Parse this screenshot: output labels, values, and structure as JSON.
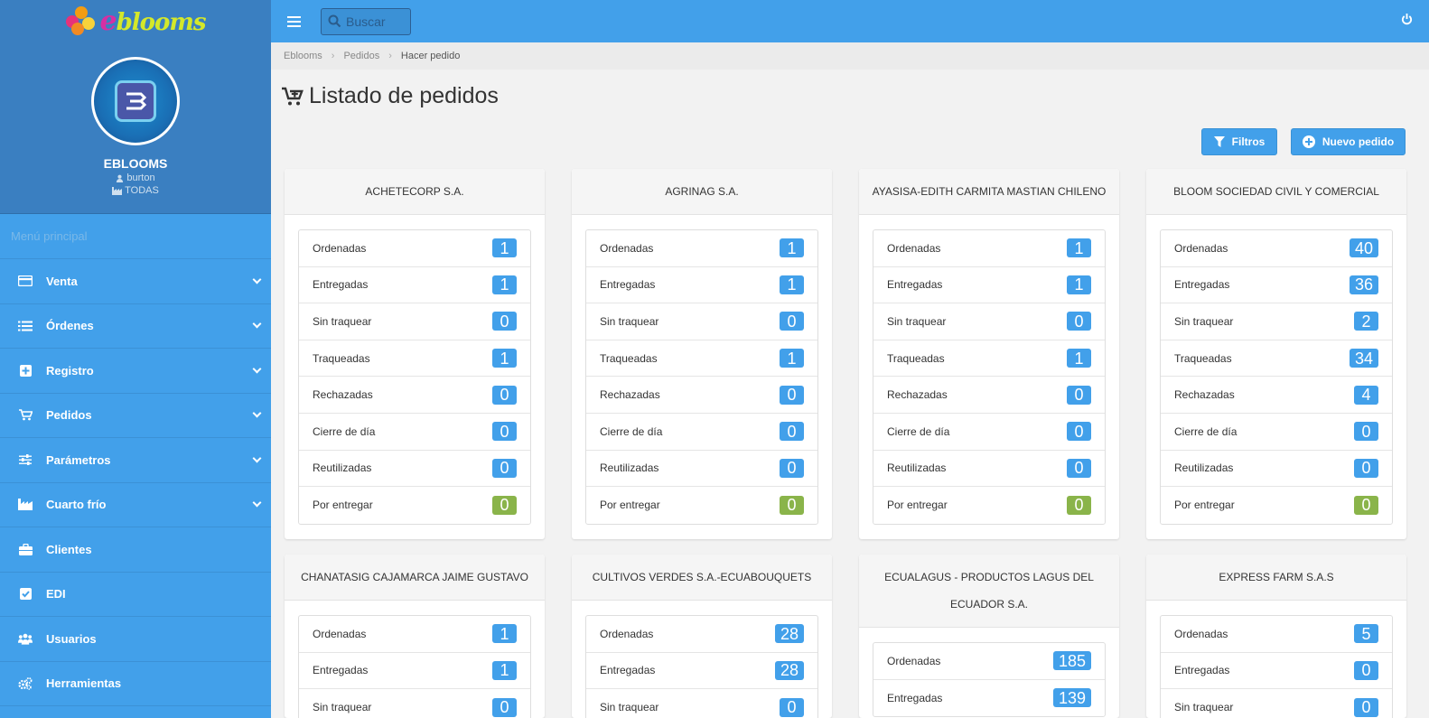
{
  "brand": {
    "logo_text": "blooms",
    "logo_initial": "e"
  },
  "profile": {
    "name": "EBLOOMS",
    "user": "burton",
    "farm": "TODAS"
  },
  "menu": {
    "label": "Menú principal",
    "items": [
      {
        "label": "Venta",
        "icon": "credit-card-icon",
        "expandable": true
      },
      {
        "label": "Órdenes",
        "icon": "list-icon",
        "expandable": true
      },
      {
        "label": "Registro",
        "icon": "plus-square-icon",
        "expandable": true
      },
      {
        "label": "Pedidos",
        "icon": "cart-icon",
        "expandable": true
      },
      {
        "label": "Parámetros",
        "icon": "sliders-icon",
        "expandable": true
      },
      {
        "label": "Cuarto frío",
        "icon": "factory-icon",
        "expandable": true
      },
      {
        "label": "Clientes",
        "icon": "briefcase-icon",
        "expandable": false
      },
      {
        "label": "EDI",
        "icon": "check-square-icon",
        "expandable": false
      },
      {
        "label": "Usuarios",
        "icon": "users-icon",
        "expandable": false
      },
      {
        "label": "Herramientas",
        "icon": "cogs-icon",
        "expandable": false
      }
    ]
  },
  "topbar": {
    "search_placeholder": "Buscar"
  },
  "breadcrumb": [
    "Eblooms",
    "Pedidos",
    "Hacer pedido"
  ],
  "page": {
    "title": "Listado de pedidos"
  },
  "buttons": {
    "filters": "Filtros",
    "new_order": "Nuevo pedido"
  },
  "stat_labels": [
    "Ordenadas",
    "Entregadas",
    "Sin traquear",
    "Traqueadas",
    "Rechazadas",
    "Cierre de día",
    "Reutilizadas",
    "Por entregar"
  ],
  "cards": [
    {
      "name": "ACHETECORP S.A.",
      "values": [
        "1",
        "1",
        "0",
        "1",
        "0",
        "0",
        "0",
        "0"
      ]
    },
    {
      "name": "AGRINAG S.A.",
      "values": [
        "1",
        "1",
        "0",
        "1",
        "0",
        "0",
        "0",
        "0"
      ]
    },
    {
      "name": "AYASISA-EDITH CARMITA MASTIAN CHILENO",
      "values": [
        "1",
        "1",
        "0",
        "1",
        "0",
        "0",
        "0",
        "0"
      ]
    },
    {
      "name": "BLOOM SOCIEDAD CIVIL Y COMERCIAL",
      "values": [
        "40",
        "36",
        "2",
        "34",
        "4",
        "0",
        "0",
        "0"
      ]
    },
    {
      "name": "CHANATASIG CAJAMARCA JAIME GUSTAVO",
      "values": [
        "1",
        "1",
        "0"
      ]
    },
    {
      "name": "CULTIVOS VERDES S.A.-ECUABOUQUETS",
      "values": [
        "28",
        "28",
        "0"
      ]
    },
    {
      "name": "ECUALAGUS - PRODUCTOS LAGUS DEL ECUADOR S.A.",
      "values": [
        "185",
        "139"
      ]
    },
    {
      "name": "EXPRESS FARM S.A.S",
      "values": [
        "5",
        "0",
        "0"
      ]
    }
  ],
  "colors": {
    "primary": "#42a0ea",
    "sidebar_dark": "#3a7fc1",
    "badge_green": "#8ab44a"
  }
}
